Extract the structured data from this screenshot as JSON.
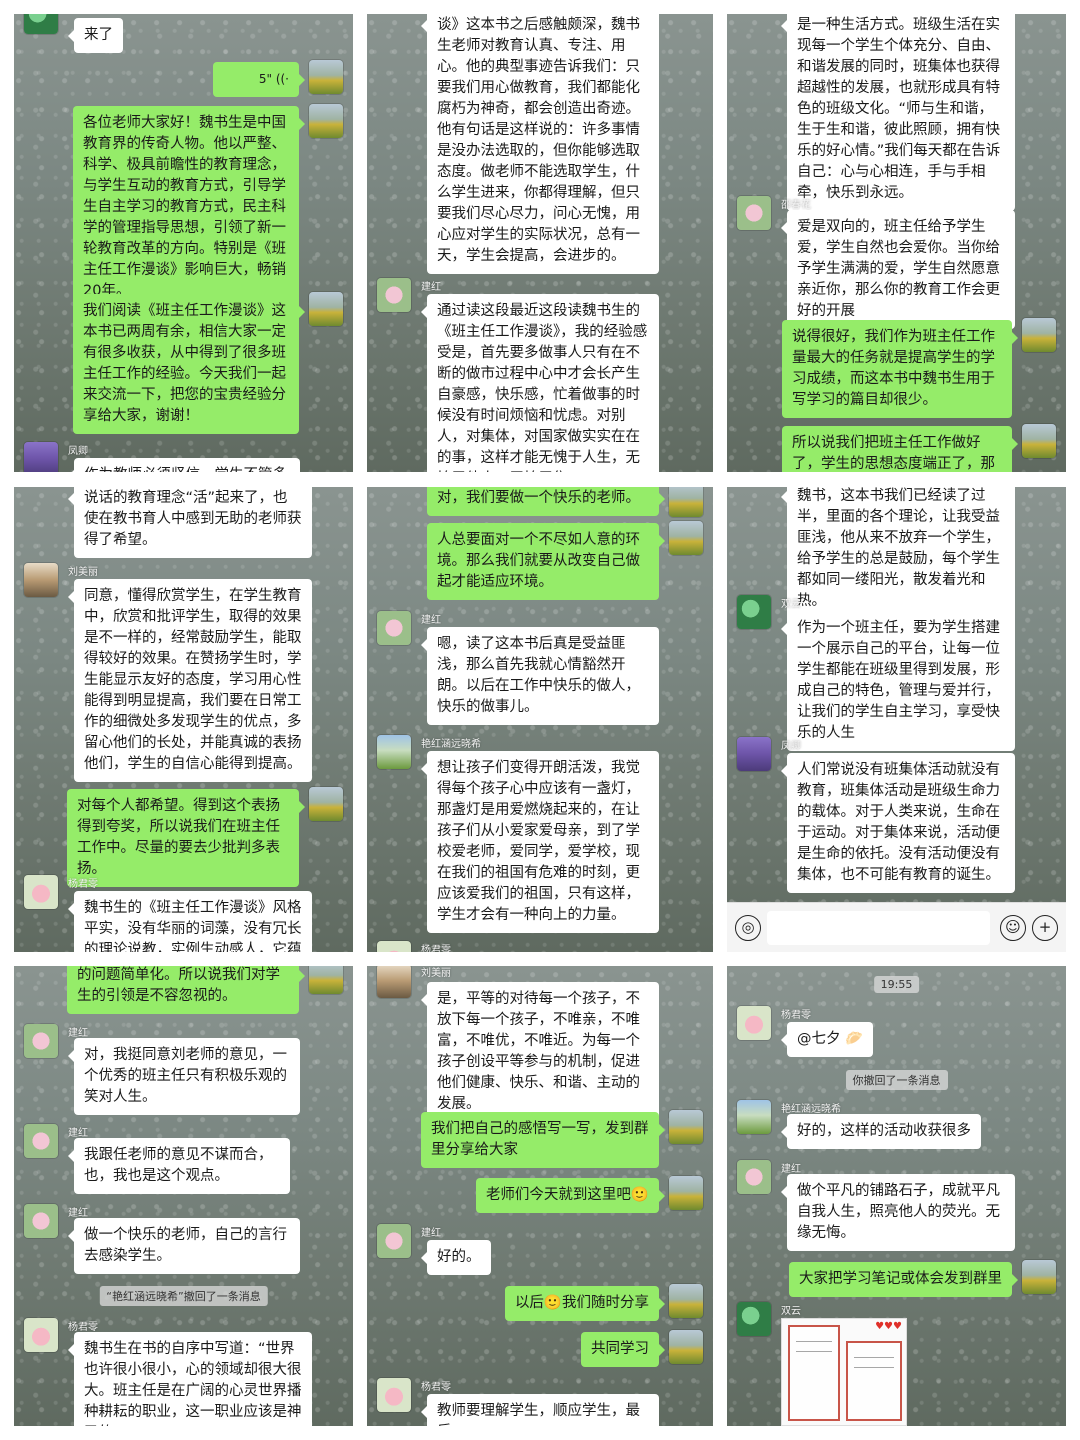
{
  "panel1": {
    "m1": "来了",
    "m2": "5\" ((·",
    "m3": "各位老师大家好！魏书生是中国教育界的传奇人物。他以严整、科学、极具前瞻性的教育理念，与学生互动的教育方式，引导学生自主学习的教育方式，民主科学的管理指导思想，引领了新一轮教育改革的方向。特别是《班主任工作漫谈》影响巨大，畅销20年。",
    "m4": "我们阅读《班主任工作漫谈》这本书已两周有余，相信大家一定有很多收获，从中得到了很多班主任工作的经验。今天我们一起来交流一下，把您的宝贵经验分享给大家，谢谢！",
    "n5": "凤卿",
    "m5": "作为教师必须坚信，学生不管多么"
  },
  "panel2": {
    "m1": "谈》这本书之后感触颇深，魏书生老师对教育认真、专注、用心。他的典型事迹告诉我们：只要我们用心做教育，我们都能化腐朽为神奇，都会创造出奇迹。他有句话是这样说的：许多事情是没办法选取的，但你能够选取态度。做老师不能选取学生，什么学生进来，你都得理解，但只要我们尽心尽力，问心无愧，用心应对学生的实际状况，总有一天，学生会提高，会进步的。",
    "n2": "建红",
    "m2": "通过读这段最近这段读魏书生的《班主任工作漫谈》，我的经验感受是，首先要多做事人只有在不断的做市过程中心中才会长产生自豪感，快乐感，忙着做事的时候没有时间烦恼和忧虑。对别人，对集体，对国家做实实在在的事，这样才能无愧于人生，无愧于他人，无愧于集"
  },
  "panel3": {
    "m1": "是一种生活方式。班级生活在实现每一个学生个体充分、自由、和谐发展的同时，班集体也获得超越性的发展，也就形成具有特色的班级文化。“师与生和谐，生于生和谐，彼此照顾，拥有快乐的好心情。”我们每天都在告诉自己：心与心相连，手与手相牵，快乐到永远。",
    "n2": "邵春花",
    "m2": "爱是双向的，班主任给予学生爱，学生自然也会爱你。当你给予学生满满的爱，学生自然愿意亲近你，那么你的教育工作会更好的开展",
    "m3": "说得很好，我们作为班主任工作量最大的任务就是提高学生的学习成绩，而这本书中魏书生用于写学习的篇目却很少。",
    "m4": "所以说我们把班主任工作做好了，学生的思想态度端正了，那么成绩"
  },
  "panel4": {
    "m1": "说话的教育理念“活”起来了，也使在教书育人中感到无助的老师获得了希望。",
    "n2": "刘美丽",
    "m2": "同意，懂得欣赏学生，在学生教育中，欣赏和批评学生，取得的效果是不一样的，经常鼓励学生，能取得较好的效果。在赞扬学生时，学生能显示友好的态度，学习用心性能得到明显提高，我们要在日常工作的细微处多发现学生的优点，多留心他们的长处，并能真诚的表扬他们，学生的自信心能得到提高。",
    "m3": "对每个人都希望。得到这个表扬得到夸奖，所以说我们在班主任工作中。尽量的要去少批判多表扬。",
    "n4": "杨君零",
    "m4": "魏书生的《班主任工作漫谈》风格平实，没有华丽的词藻，没有冗长的理论说教，实例生动感人，它蕴"
  },
  "panel5": {
    "m1": "对，我们要做一个快乐的老师。",
    "m2": "人总要面对一个不尽如人意的环境。那么我们就要从改变自己做起才能适应环境。",
    "n3": "建红",
    "m3": "嗯，读了这本书后真是受益匪浅，那么首先我就心情豁然开朗。以后在工作中快乐的做人，快乐的做事儿。",
    "n4": "艳红涵远晓希",
    "m4": "想让孩子们变得开朗活泼，我觉得每个孩子心中应该有一盏灯，那盏灯是用爱燃烧起来的，在让孩子们从小爱家爱母亲，到了学校爱老师，爱同学，爱学校，现在我们的祖国有危难的时刻，更应该爱我们的祖国，只有这样，学生才会有一种向上的力量。",
    "n5": "杨君零"
  },
  "panel6": {
    "m1": "魏书，这本书我们已经读了过半，里面的各个理论，让我受益匪浅，他从来不放弃一个学生，给予学生的总是鼓励，每个学生都如同一缕阳光，散发着光和热。",
    "n2": "双云",
    "m2": "作为一个班主任，要为学生搭建一个展示自己的平台，让每一位学生都能在班级里得到发展，形成自己的特色，管理与爱并行，让我们的学生自主学习，享受快乐的人生",
    "n3": "凤卿",
    "m3": "人们常说没有班集体活动就没有教育，班集体活动是班级生命力的载体。对于人类来说，生命在于运动。对于集体来说，活动便是生命的依托。没有活动便没有集体，也不可能有教育的诞生。",
    "voice_icon": "◎",
    "emoji_icon": "☺",
    "plus_icon": "+"
  },
  "panel7": {
    "m1": "的问题简单化。所以说我们对学生的引领是不容忽视的。",
    "n2": "建红",
    "m2": "对，我挺同意刘老师的意见，一个优秀的班主任只有积极乐观的笑对人生。",
    "n3": "建红",
    "m3": "我跟任老师的意见不谋而合，也，我也是这个观点。",
    "n4": "建红",
    "m4": "做一个快乐的老师，自己的言行去感染学生。",
    "sys": "“艳红涵远晓希”撤回了一条消息",
    "n5": "杨君零",
    "m5": "魏书生在书的自序中写道：“世界也许很小很小，心的领域却很大很大。班主任是在广阔的心灵世界播种耕耘的职业，这一职业应该是神圣的。"
  },
  "panel8": {
    "n1": "刘美丽",
    "m1": "是，平等的对待每一个孩子，不放下每一个孩子，不唯亲，不唯富，不唯优，不唯近。为每一个孩子创设平等参与的机制，促进他们健康、快乐、和谐、主动的发展。",
    "m2": "我们把自己的感悟写一写，发到群里分享给大家",
    "m3": "老师们今天就到这里吧🙂",
    "n4": "建红",
    "m4": "好的。",
    "m5": "以后🙂我们随时分享",
    "m6": "共同学习",
    "n7": "杨君零",
    "m7": "教师要理解学生，顺应学生，最后"
  },
  "panel9": {
    "time": "19:55",
    "n1": "杨君零",
    "m1": "@七夕 🥟",
    "sys": "你撤回了一条消息",
    "n2": "艳红涵远晓希",
    "m2": "好的，这样的活动收获很多",
    "n3": "建红",
    "m3": "做个平凡的铺路石子，成就平凡自我人生，照亮他人的荧光。无缘无悔。",
    "m4": "大家把学习笔记或体会发到群里",
    "n5": "双云",
    "hearts": "♥♥♥"
  }
}
